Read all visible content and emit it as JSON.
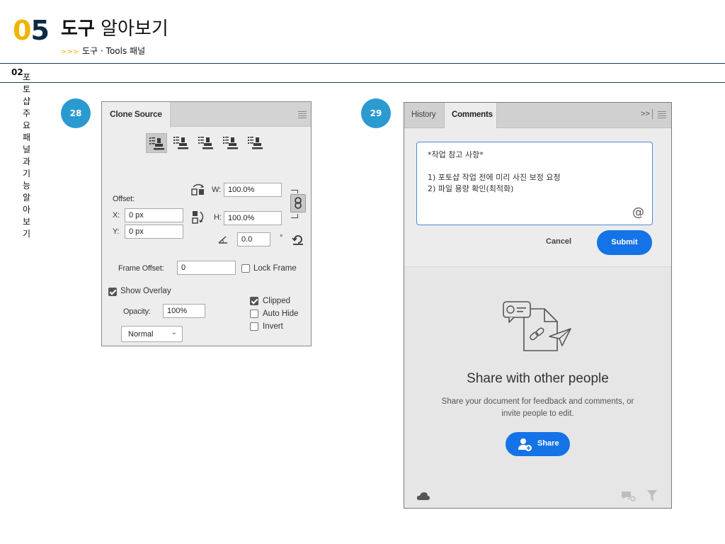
{
  "header": {
    "chapter_num_a": "0",
    "chapter_num_b": "5",
    "title_bold": "도구",
    "title_rest": " 알아보기",
    "sub_arrows": ">>>",
    "subtitle": "도구 · Tools 패널",
    "section_num": "02",
    "section_title": " 포토샵 주요 패널과 기능 알아보기"
  },
  "badges": {
    "left": "28",
    "right": "29"
  },
  "clone_source": {
    "tab_label": "Clone Source",
    "offset_label": "Offset:",
    "w_label": "W:",
    "w_value": "100.0%",
    "h_label": "H:",
    "h_value": "100.0%",
    "x_label": "X:",
    "x_value": "0 px",
    "y_label": "Y:",
    "y_value": "0 px",
    "angle_value": "0.0",
    "degree_symbol": "°",
    "frame_offset_label": "Frame Offset:",
    "frame_offset_value": "0",
    "lock_frame_label": "Lock Frame",
    "lock_frame_checked": false,
    "show_overlay_label": "Show Overlay",
    "show_overlay_checked": true,
    "opacity_label": "Opacity:",
    "opacity_value": "100%",
    "clipped_label": "Clipped",
    "clipped_checked": true,
    "auto_hide_label": "Auto Hide",
    "auto_hide_checked": false,
    "invert_label": "Invert",
    "invert_checked": false,
    "blend_mode": "Normal",
    "blend_caret": "⌄"
  },
  "comments": {
    "tabs": [
      "History",
      "Comments"
    ],
    "active_tab": "Comments",
    "tab_overflow": ">>",
    "comment_lines": [
      "*작업 참고 사항*",
      "",
      "1) 포토샵 작업 전에 미리 사진 보정 요청",
      "2) 파일 용량 확인(최적화)"
    ],
    "mention_symbol": "@",
    "cancel_label": "Cancel",
    "submit_label": "Submit",
    "share_title": "Share with other people",
    "share_desc_line1": "Share your document for feedback and comments, or",
    "share_desc_line2": "invite people to edit.",
    "share_button_label": "Share",
    "colors": {
      "accent": "#1473e6",
      "badge": "#2a9ad1",
      "focus_border": "#4a8ad4"
    }
  }
}
